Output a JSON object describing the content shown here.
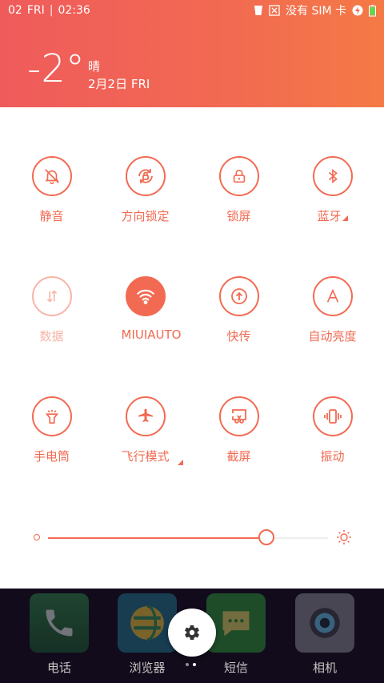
{
  "status_bar": {
    "date": "02",
    "day": "FRI",
    "time": "02:36",
    "carrier": "没有 SIM 卡"
  },
  "weather": {
    "temperature": "-2°",
    "condition": "晴",
    "date": "2月2日 FRI"
  },
  "toggles": [
    {
      "label": "静音",
      "icon": "bell-slash-icon",
      "state": "off"
    },
    {
      "label": "方向锁定",
      "icon": "rotation-lock-icon",
      "state": "off"
    },
    {
      "label": "锁屏",
      "icon": "lock-icon",
      "state": "off"
    },
    {
      "label": "蓝牙",
      "icon": "bluetooth-icon",
      "state": "off",
      "expandable": true
    },
    {
      "label": "数据",
      "icon": "data-arrows-icon",
      "state": "disabled"
    },
    {
      "label": "MIUIAUTO",
      "icon": "wifi-icon",
      "state": "on",
      "expandable": true
    },
    {
      "label": "快传",
      "icon": "upload-icon",
      "state": "off"
    },
    {
      "label": "自动亮度",
      "icon": "auto-brightness-icon",
      "state": "off"
    },
    {
      "label": "手电筒",
      "icon": "flashlight-icon",
      "state": "off"
    },
    {
      "label": "飞行模式",
      "icon": "airplane-icon",
      "state": "off"
    },
    {
      "label": "截屏",
      "icon": "screenshot-icon",
      "state": "off"
    },
    {
      "label": "振动",
      "icon": "vibrate-icon",
      "state": "off"
    }
  ],
  "brightness": {
    "level_percent": 78
  },
  "dock": {
    "apps": [
      {
        "label": "电话",
        "icon": "phone-icon"
      },
      {
        "label": "浏览器",
        "icon": "browser-icon"
      },
      {
        "label": "短信",
        "icon": "sms-icon"
      },
      {
        "label": "相机",
        "icon": "camera-icon"
      }
    ]
  },
  "colors": {
    "accent": "#f26a52",
    "header_start": "#ef5b5b",
    "header_end": "#f47a45"
  },
  "pager": {
    "pages": 2,
    "current": 2
  }
}
